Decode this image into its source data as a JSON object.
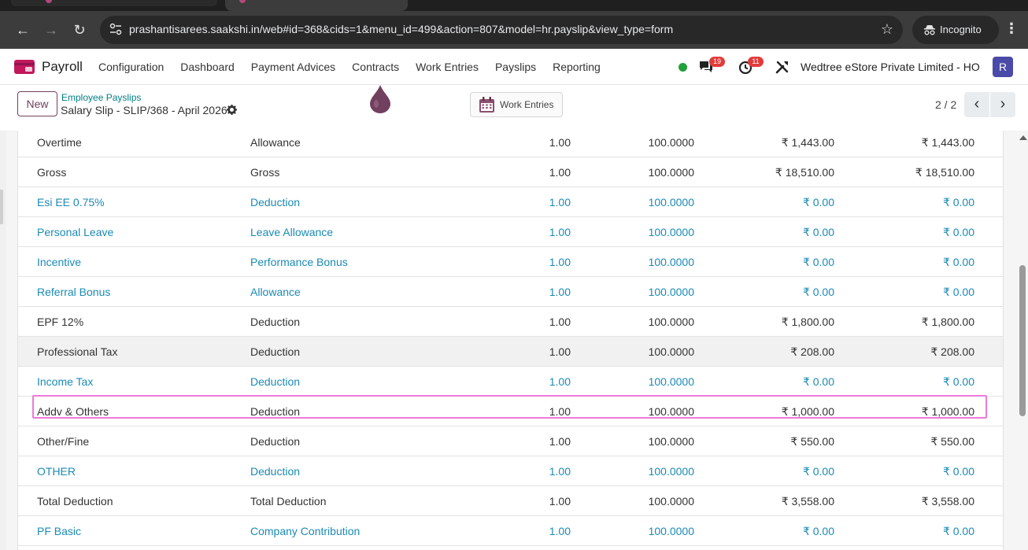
{
  "browser": {
    "url": "prashantisarees.saakshi.in/web#id=368&cids=1&menu_id=499&action=807&model=hr.payslip&view_type=form",
    "incognito_label": "Incognito"
  },
  "navbar": {
    "app_name": "Payroll",
    "menu": [
      "Configuration",
      "Dashboard",
      "Payment Advices",
      "Contracts",
      "Work Entries",
      "Payslips",
      "Reporting"
    ],
    "messages_count": "19",
    "activities_count": "11",
    "company": "Wedtree eStore Private Limited - HO",
    "avatar_initial": "R"
  },
  "control_panel": {
    "new_label": "New",
    "breadcrumb": "Employee Payslips",
    "record_title": "Salary Slip - SLIP/368 - April 2026",
    "work_entries_label": "Work Entries",
    "pager": "2 / 2"
  },
  "lines": [
    {
      "name": "Overtime",
      "category": "Allowance",
      "qty": "1.00",
      "rate": "100.0000",
      "amount": "₹ 1,443.00",
      "total": "₹ 1,443.00",
      "link": false
    },
    {
      "name": "Gross",
      "category": "Gross",
      "qty": "1.00",
      "rate": "100.0000",
      "amount": "₹ 18,510.00",
      "total": "₹ 18,510.00",
      "link": false
    },
    {
      "name": "Esi EE 0.75%",
      "category": "Deduction",
      "qty": "1.00",
      "rate": "100.0000",
      "amount": "₹ 0.00",
      "total": "₹ 0.00",
      "link": true
    },
    {
      "name": "Personal Leave",
      "category": "Leave Allowance",
      "qty": "1.00",
      "rate": "100.0000",
      "amount": "₹ 0.00",
      "total": "₹ 0.00",
      "link": true
    },
    {
      "name": "Incentive",
      "category": "Performance Bonus",
      "qty": "1.00",
      "rate": "100.0000",
      "amount": "₹ 0.00",
      "total": "₹ 0.00",
      "link": true
    },
    {
      "name": "Referral Bonus",
      "category": "Allowance",
      "qty": "1.00",
      "rate": "100.0000",
      "amount": "₹ 0.00",
      "total": "₹ 0.00",
      "link": true
    },
    {
      "name": "EPF 12%",
      "category": "Deduction",
      "qty": "1.00",
      "rate": "100.0000",
      "amount": "₹ 1,800.00",
      "total": "₹ 1,800.00",
      "link": false
    },
    {
      "name": "Professional Tax",
      "category": "Deduction",
      "qty": "1.00",
      "rate": "100.0000",
      "amount": "₹ 208.00",
      "total": "₹ 208.00",
      "link": false,
      "hover": true
    },
    {
      "name": "Income Tax",
      "category": "Deduction",
      "qty": "1.00",
      "rate": "100.0000",
      "amount": "₹ 0.00",
      "total": "₹ 0.00",
      "link": true
    },
    {
      "name": "Addv & Others",
      "category": "Deduction",
      "qty": "1.00",
      "rate": "100.0000",
      "amount": "₹ 1,000.00",
      "total": "₹ 1,000.00",
      "link": false
    },
    {
      "name": "Other/Fine",
      "category": "Deduction",
      "qty": "1.00",
      "rate": "100.0000",
      "amount": "₹ 550.00",
      "total": "₹ 550.00",
      "link": false
    },
    {
      "name": "OTHER",
      "category": "Deduction",
      "qty": "1.00",
      "rate": "100.0000",
      "amount": "₹ 0.00",
      "total": "₹ 0.00",
      "link": true
    },
    {
      "name": "Total Deduction",
      "category": "Total Deduction",
      "qty": "1.00",
      "rate": "100.0000",
      "amount": "₹ 3,558.00",
      "total": "₹ 3,558.00",
      "link": false
    },
    {
      "name": "PF Basic",
      "category": "Company Contribution",
      "qty": "1.00",
      "rate": "100.0000",
      "amount": "₹ 0.00",
      "total": "₹ 0.00",
      "link": true
    }
  ],
  "colors": {
    "brand": "#71405e",
    "link": "#1b8ab5",
    "highlight": "#ee7ad8",
    "badge": "#e23b3b"
  }
}
